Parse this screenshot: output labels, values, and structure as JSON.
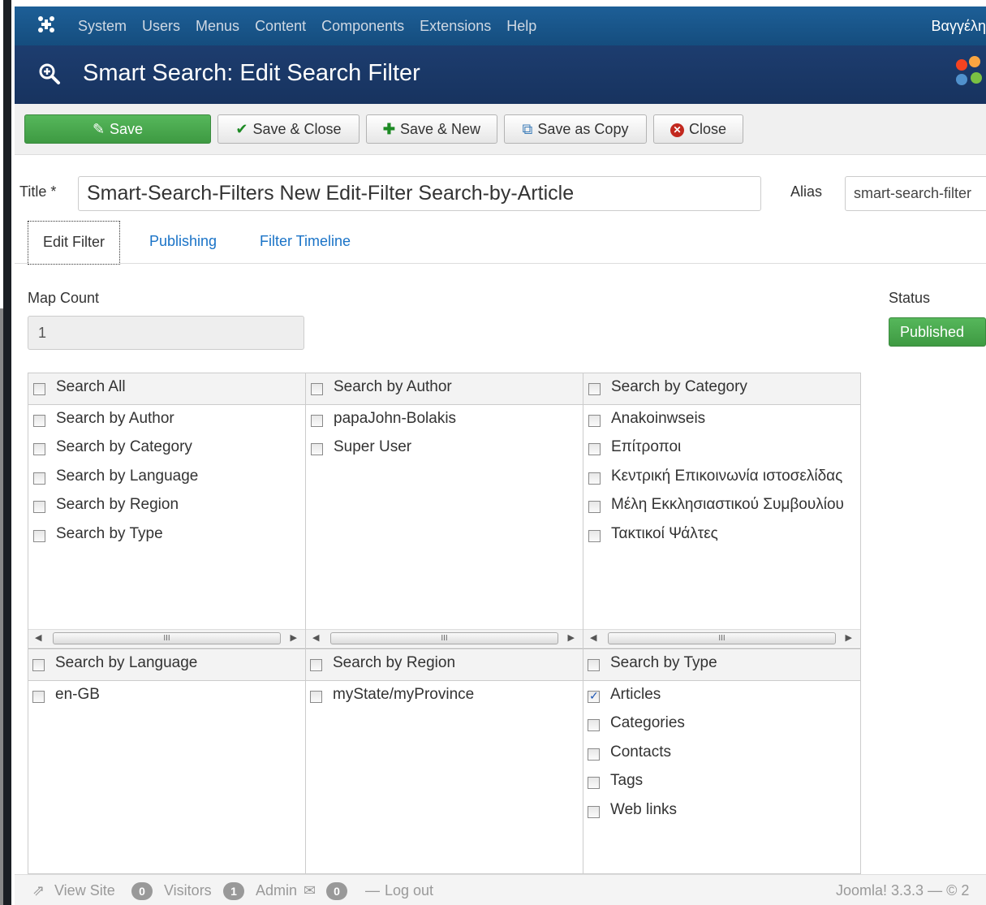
{
  "navbar": {
    "logo_icon": "joomla-x-icon",
    "menu": [
      "System",
      "Users",
      "Menus",
      "Content",
      "Components",
      "Extensions",
      "Help"
    ],
    "user": "Βαγγέλη"
  },
  "header": {
    "icon": "zoom-icon",
    "title": "Smart Search: Edit Search Filter"
  },
  "toolbar": {
    "save": "Save",
    "save_close": "Save & Close",
    "save_new": "Save & New",
    "save_copy": "Save as Copy",
    "close": "Close"
  },
  "form": {
    "title_label": "Title *",
    "title_value": "Smart-Search-Filters  New  Edit-Filter  Search-by-Article",
    "alias_label": "Alias",
    "alias_value": "smart-search-filter"
  },
  "tabs": [
    "Edit Filter",
    "Publishing",
    "Filter Timeline"
  ],
  "map_count": {
    "label": "Map Count",
    "value": "1"
  },
  "status": {
    "label": "Status",
    "value": "Published"
  },
  "filters": {
    "search_all": {
      "header": "Search All",
      "items": [
        "Search by Author",
        "Search by Category",
        "Search by Language",
        "Search by Region",
        "Search by Type"
      ]
    },
    "author": {
      "header": "Search by Author",
      "items": [
        "papaJohn-Bolakis",
        "Super User"
      ]
    },
    "category": {
      "header": "Search by Category",
      "items": [
        "Anakoinwseis",
        "Επίτροποι",
        "Κεντρική Επικοινωνία ιστοσελίδας",
        "Μέλη Εκκλησιαστικού Συμβουλίου",
        "Τακτικοί Ψάλτες"
      ]
    },
    "language": {
      "header": "Search by Language",
      "items": [
        "en-GB"
      ]
    },
    "region": {
      "header": "Search by Region",
      "items": [
        "myState/myProvince"
      ]
    },
    "type": {
      "header": "Search by Type",
      "items": [
        "Articles",
        "Categories",
        "Contacts",
        "Tags",
        "Web links"
      ],
      "checked": [
        true,
        false,
        false,
        false,
        false
      ]
    }
  },
  "footer": {
    "view_site": "View Site",
    "visitors_count": "0",
    "visitors": "Visitors",
    "admin_count": "1",
    "admin": "Admin",
    "messages_count": "0",
    "logout": "Log out",
    "version": "Joomla! 3.3.3 — © 2"
  }
}
